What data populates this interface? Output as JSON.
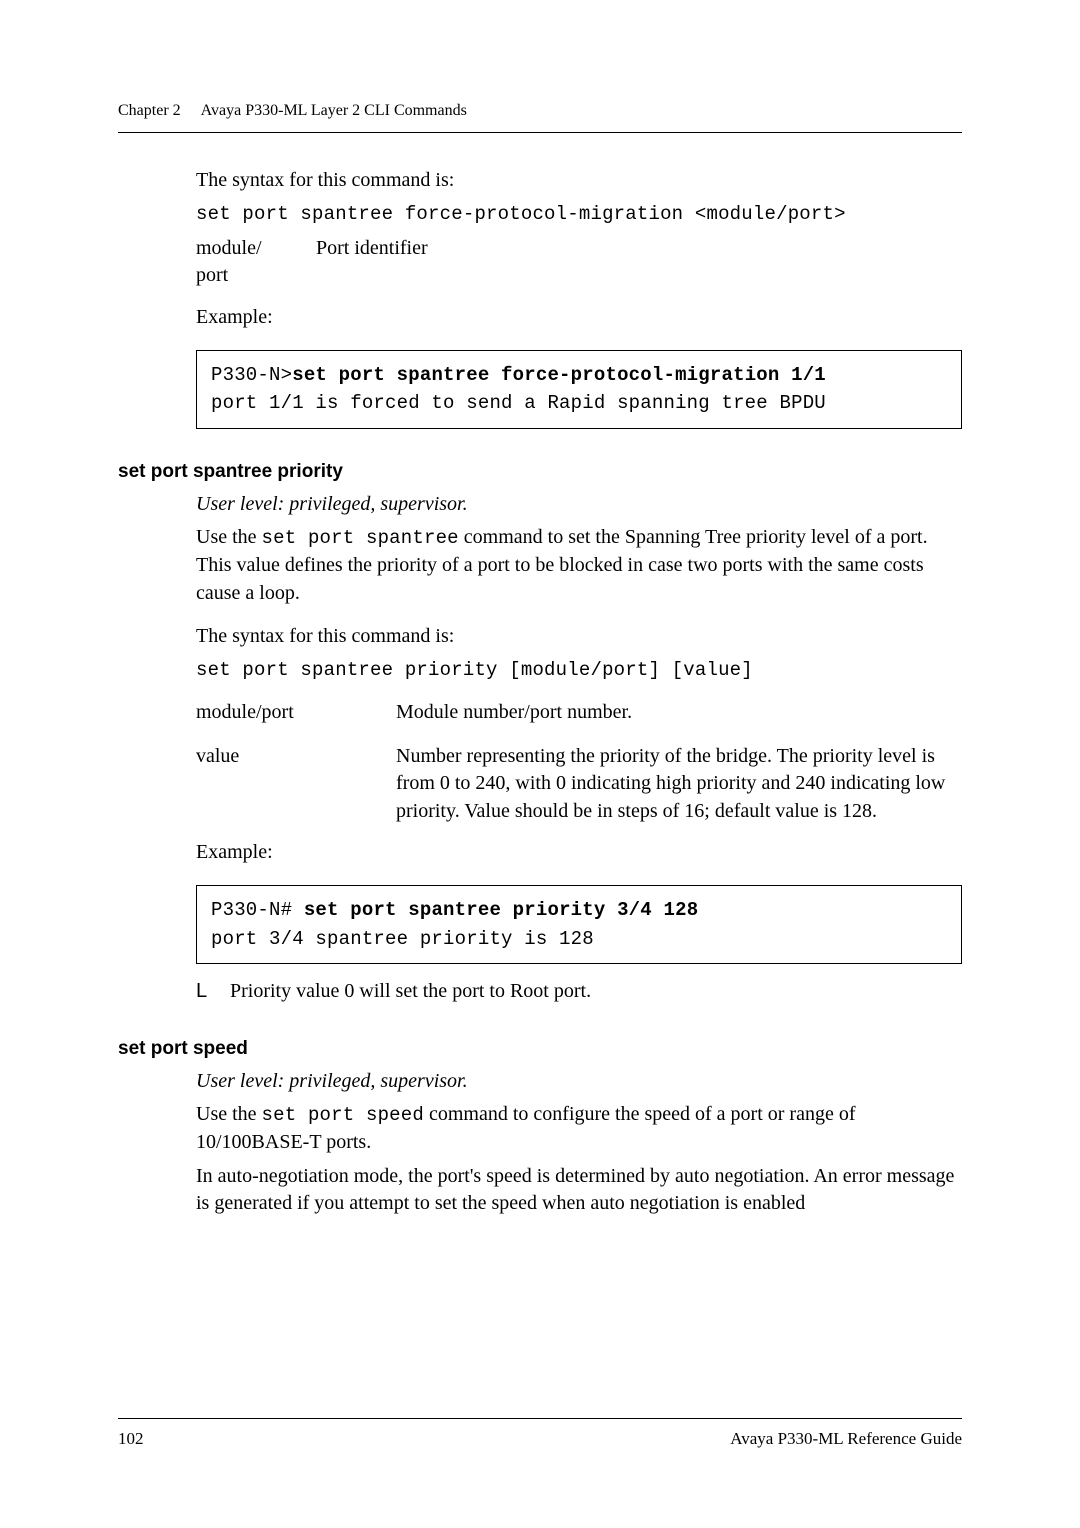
{
  "header": {
    "chapter": "Chapter 2",
    "title": "Avaya P330-ML Layer 2 CLI Commands"
  },
  "sec1": {
    "intro": "The syntax for this command is:",
    "syntax": "set port spantree force-protocol-migration <module/port>",
    "param_key_line1": "module/",
    "param_key_line2": "port",
    "param_val": "Port identifier",
    "example_label": "Example:",
    "code_line1_a": "P330-N>",
    "code_line1_b": "set port spantree force-protocol-migration 1/1",
    "code_line2": "port 1/1 is forced to send a Rapid spanning tree BPDU"
  },
  "sec2": {
    "heading": "set port spantree priority",
    "userlevel": "User level: privileged, supervisor.",
    "para_a": "Use the ",
    "para_code": "set port spantree",
    "para_b": " command to set the Spanning Tree priority level of a port. This value defines the priority of a port to be blocked in case two ports with the same costs cause a loop.",
    "syntax_intro": "The syntax for this command is:",
    "syntax": "set port spantree priority [module/port] [value]",
    "p1_key": "module/port",
    "p1_val": "Module number/port number.",
    "p2_key": "value",
    "p2_val": "Number representing the priority of the bridge. The priority level is from 0 to 240, with 0 indicating high priority and 240 indicating low priority. Value should be in steps of 16; default value is 128.",
    "example_label": "Example:",
    "code_line1_a": "P330-N# ",
    "code_line1_b": "set port spantree priority 3/4 128",
    "code_line2": "port 3/4 spantree priority is 128",
    "note_bullet": "L",
    "note_text": "Priority value 0 will set the port to Root port."
  },
  "sec3": {
    "heading": "set port speed",
    "userlevel": "User level: privileged, supervisor.",
    "para_a": "Use the ",
    "para_code": "set port speed",
    "para_b": " command to configure the speed of a port or range of 10/100BASE-T ports.",
    "para2": "In auto-negotiation mode, the port's speed is determined by auto negotiation. An error message is generated if you attempt to set the speed when auto negotiation is enabled"
  },
  "footer": {
    "page": "102",
    "book": "Avaya P330-ML Reference Guide"
  }
}
